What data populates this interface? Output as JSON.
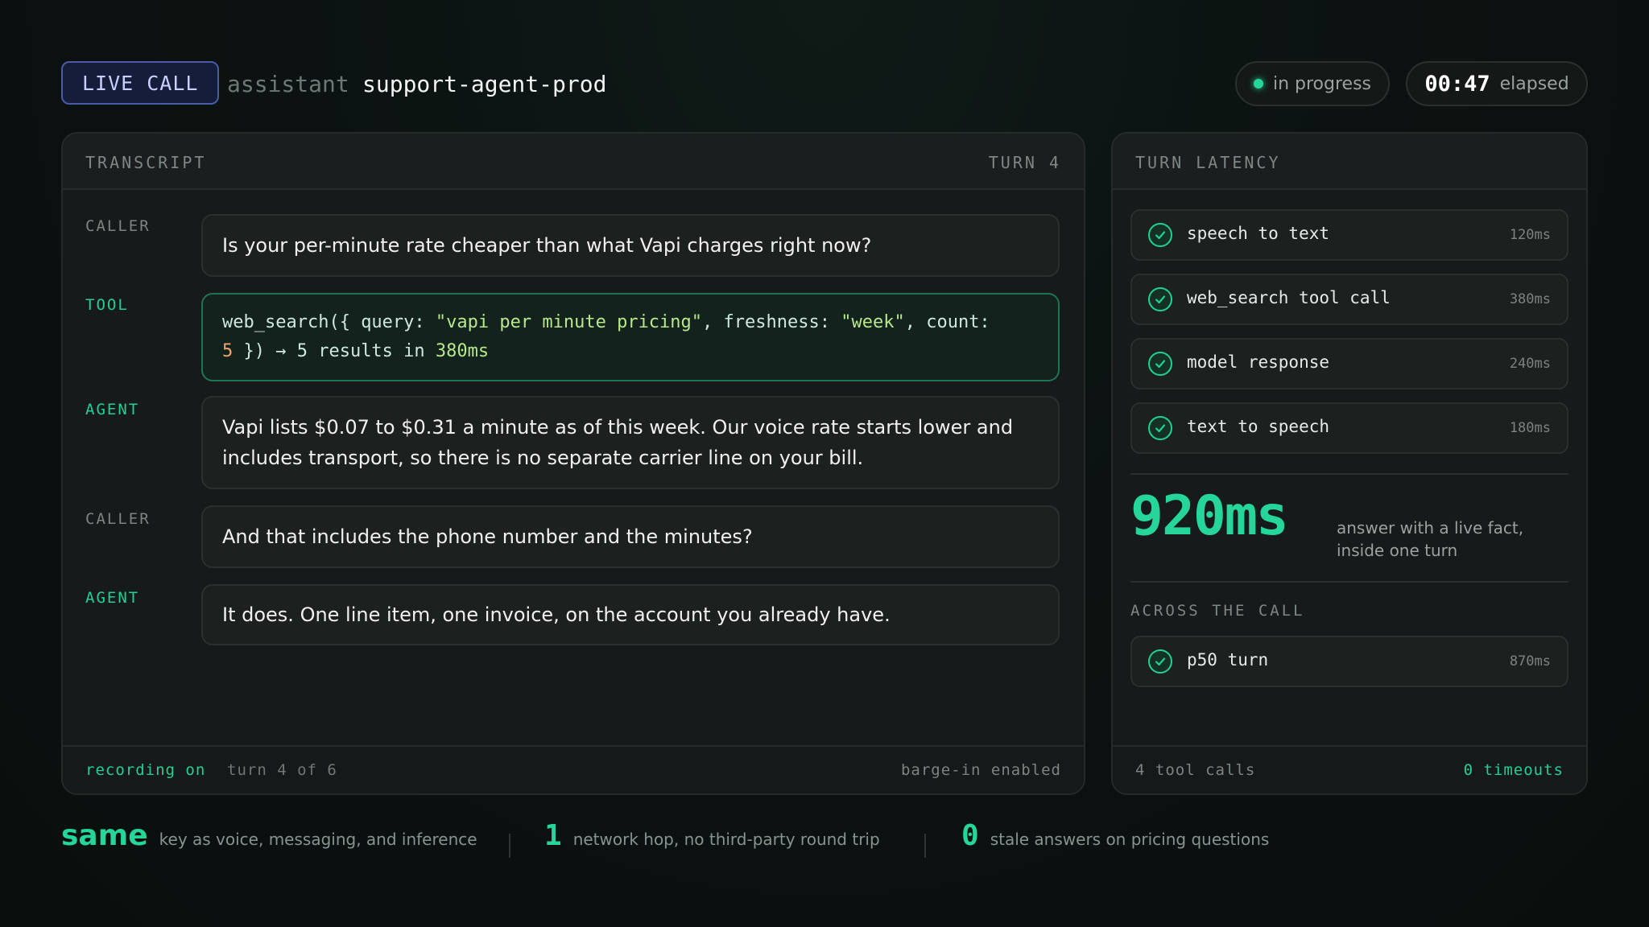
{
  "header": {
    "badge": "LIVE CALL",
    "assistant_label": "assistant",
    "assistant_name": "support-agent-prod",
    "status": "in progress",
    "elapsed_value": "00:47",
    "elapsed_label": "elapsed"
  },
  "transcript": {
    "title": "TRANSCRIPT",
    "turn_label": "TURN 4",
    "messages": [
      {
        "speaker": "CALLER",
        "text": "Is your per-minute rate cheaper than what Vapi charges right now?"
      },
      {
        "speaker": "TOOL",
        "call": {
          "fn": "web_search({ ",
          "k1": "query: ",
          "v1": "\"vapi per minute pricing\"",
          "k2": ", freshness: ",
          "v2": "\"week\"",
          "k3": ", count: ",
          "v3": "5",
          "tail1": " }) → 5 results in ",
          "tail2": "380ms"
        }
      },
      {
        "speaker": "AGENT",
        "text": "Vapi lists $0.07 to $0.31 a minute as of this week. Our voice rate starts lower and includes transport, so there is no separate carrier line on your bill."
      },
      {
        "speaker": "CALLER",
        "text": "And that includes the phone number and the minutes?"
      },
      {
        "speaker": "AGENT",
        "text": "It does. One line item, one invoice, on the account you already have."
      }
    ],
    "footer": {
      "recording": "recording on",
      "turn_progress": "turn 4 of 6",
      "barge": "barge-in enabled"
    }
  },
  "latency": {
    "title": "TURN LATENCY",
    "stages": [
      {
        "label": "speech to text",
        "ms": "120ms"
      },
      {
        "label": "web_search tool call",
        "ms": "380ms"
      },
      {
        "label": "model response",
        "ms": "240ms"
      },
      {
        "label": "text to speech",
        "ms": "180ms"
      }
    ],
    "total": "920ms",
    "total_caption": "answer with a live fact, inside one turn",
    "across_title": "ACROSS THE CALL",
    "across": [
      {
        "label": "p50 turn",
        "ms": "870ms"
      }
    ],
    "footer": {
      "tool_calls": "4 tool calls",
      "timeouts": "0 timeouts"
    }
  },
  "stats": [
    {
      "big": "same",
      "text": "key as voice, messaging, and inference"
    },
    {
      "big": "1",
      "text": "network hop, no third-party round trip"
    },
    {
      "big": "0",
      "text": "stale answers on pricing questions"
    }
  ],
  "colors": {
    "accent": "#25d59a",
    "badge": "#c6cffd",
    "tool_string": "#b7e889",
    "tool_number": "#f0a66a"
  },
  "icons": {
    "status": "status-dot-icon",
    "stage": "check-circle-icon"
  }
}
